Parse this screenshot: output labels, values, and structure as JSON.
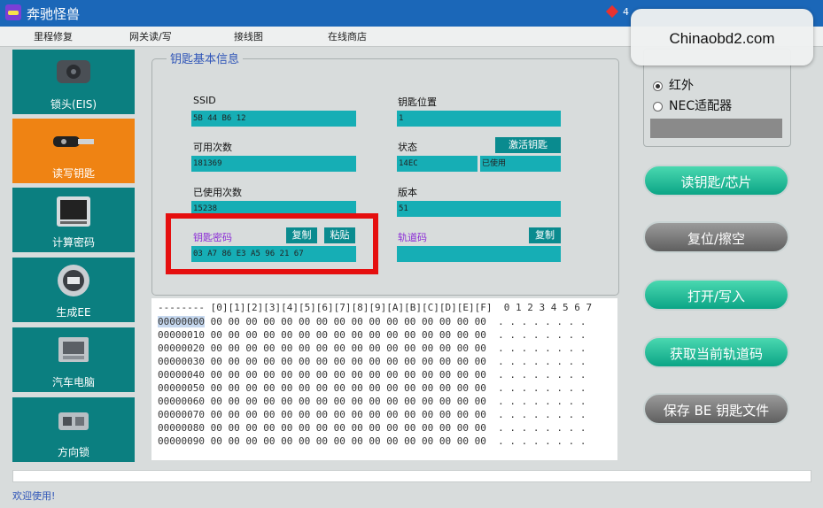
{
  "window": {
    "title": "奔驰怪兽",
    "gem_count": "4"
  },
  "watermark": "Chinaobd2.com",
  "menu": [
    "里程修复",
    "网关读/写",
    "接线图",
    "在线商店"
  ],
  "sidebar": [
    {
      "label": "锁头(EIS)",
      "icon": "eis-lock-icon"
    },
    {
      "label": "读写钥匙",
      "icon": "key-icon"
    },
    {
      "label": "计算密码",
      "icon": "calculator-screen-icon"
    },
    {
      "label": "生成EE",
      "icon": "generate-ee-icon"
    },
    {
      "label": "汽车电脑",
      "icon": "ecu-icon"
    },
    {
      "label": "方向锁",
      "icon": "steering-lock-icon"
    }
  ],
  "key_info": {
    "title": "钥匙基本信息",
    "ssid_label": "SSID",
    "ssid_value": "5B 44 B6 12",
    "position_label": "钥匙位置",
    "position_value": "1",
    "uses_label": "可用次数",
    "uses_value": "181369",
    "status_label": "状态",
    "activate_button": "激活钥匙",
    "status_code": "14EC",
    "status_value": "已使用",
    "used_label": "已使用次数",
    "used_value": "15238",
    "version_label": "版本",
    "version_value": "51",
    "password_label": "钥匙密码",
    "copy_button": "复制",
    "paste_button": "粘贴",
    "password_value": "03 A7 86 E3 A5 96 21 67",
    "track_label": "轨道码",
    "track_copy_button": "复制",
    "track_value": ""
  },
  "hex": {
    "header": "-------- [0][1][2][3][4][5][6][7][8][9][A][B][C][D][E][F]  0 1 2 3 4 5 6 7",
    "rows": [
      "00000000 00 00 00 00 00 00 00 00 00 00 00 00 00 00 00 00  . . . . . . . .",
      "00000010 00 00 00 00 00 00 00 00 00 00 00 00 00 00 00 00  . . . . . . . .",
      "00000020 00 00 00 00 00 00 00 00 00 00 00 00 00 00 00 00  . . . . . . . .",
      "00000030 00 00 00 00 00 00 00 00 00 00 00 00 00 00 00 00  . . . . . . . .",
      "00000040 00 00 00 00 00 00 00 00 00 00 00 00 00 00 00 00  . . . . . . . .",
      "00000050 00 00 00 00 00 00 00 00 00 00 00 00 00 00 00 00  . . . . . . . .",
      "00000060 00 00 00 00 00 00 00 00 00 00 00 00 00 00 00 00  . . . . . . . .",
      "00000070 00 00 00 00 00 00 00 00 00 00 00 00 00 00 00 00  . . . . . . . .",
      "00000080 00 00 00 00 00 00 00 00 00 00 00 00 00 00 00 00  . . . . . . . .",
      "00000090 00 00 00 00 00 00 00 00 00 00 00 00 00 00 00 00  . . . . . . . ."
    ]
  },
  "radio": {
    "infrared": "红外",
    "nec_adapter": "NEC适配器",
    "selected": "infrared"
  },
  "actions": [
    "读钥匙/芯片",
    "复位/擦空",
    "打开/写入",
    "获取当前轨道码",
    "保存 BE 钥匙文件"
  ],
  "status_text": "欢迎使用!",
  "colors": {
    "title_bar": "#1b67b8",
    "teal": "#0b7f80",
    "field": "#16aeb5",
    "active_orange": "#ef8313",
    "highlight_red": "#e50f0f"
  }
}
